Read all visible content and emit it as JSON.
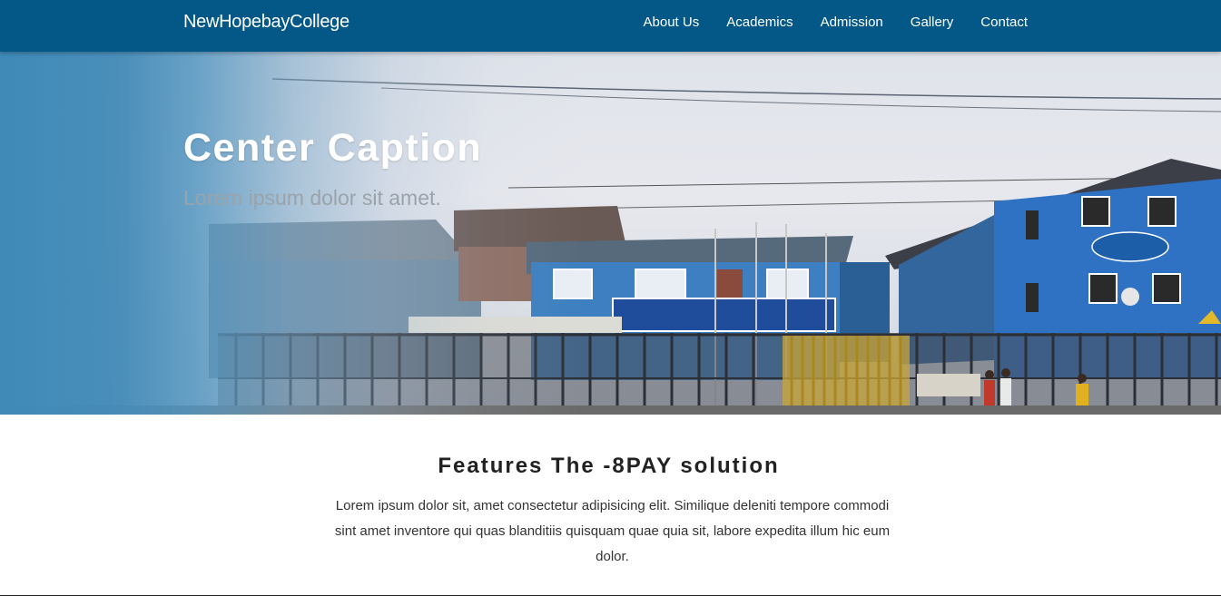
{
  "navbar": {
    "brand": "NewHopebayCollege",
    "links": [
      "About Us",
      "Academics",
      "Admission",
      "Gallery",
      "Contact"
    ]
  },
  "hero": {
    "image_alt": "school-building-photo",
    "title": "Center Caption",
    "subtitle": "Lorem ipsum dolor sit amet."
  },
  "features": {
    "title": "Features The -8PAY solution",
    "text": "Lorem ipsum dolor sit, amet consectetur adipisicing elit. Similique deleniti tempore commodi sint amet inventore qui quas blanditiis quisquam quae quia sit, labore expedita illum hic eum dolor."
  },
  "colors": {
    "navbar": "#035887",
    "hero_overlay": "#3f8ab8",
    "text_dark": "#222222"
  }
}
